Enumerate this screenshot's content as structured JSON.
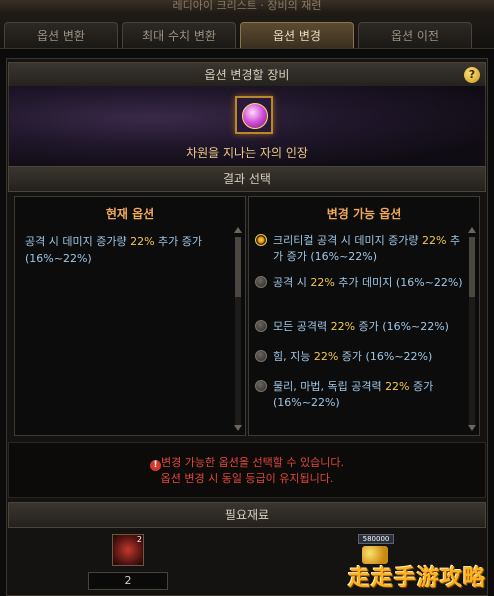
{
  "window": {
    "title": "레디아이 크리스트 · 장비의 재련"
  },
  "tabs": [
    {
      "label": "옵션 변환",
      "active": false
    },
    {
      "label": "최대 수치 변환",
      "active": false
    },
    {
      "label": "옵션 변경",
      "active": true
    },
    {
      "label": "옵션 이전",
      "active": false
    }
  ],
  "target_section": {
    "header": "옵션 변경할 장비",
    "help": "?",
    "item_name": "차원을 지나는 자의 인장"
  },
  "result_section": {
    "header": "결과 선택"
  },
  "current_options": {
    "title": "현재 옵션",
    "text_before": "공격 시 데미지 증가량 ",
    "highlight": "22%",
    "text_after": " 추가 증가 (16%~22%)"
  },
  "available_options": {
    "title": "변경 가능 옵션",
    "items": [
      {
        "before": "크리티컬 공격 시 데미지 증가량 ",
        "hl": "22%",
        "after": " 추가 증가 (16%~22%)",
        "selected": true
      },
      {
        "before": "공격 시 ",
        "hl": "22%",
        "after": " 추가 데미지 (16%~22%)",
        "selected": false
      },
      {
        "before": "모든 공격력 ",
        "hl": "22%",
        "after": " 증가 (16%~22%)",
        "selected": false
      },
      {
        "before": "힘, 지능 ",
        "hl": "22%",
        "after": " 증가 (16%~22%)",
        "selected": false
      },
      {
        "before": "물리, 마법, 독립 공격력 ",
        "hl": "22%",
        "after": " 증가 (16%~22%)",
        "selected": false
      }
    ]
  },
  "notice": {
    "line1": "변경 가능한 옵션을 선택할 수 있습니다.",
    "line2": "옵션 변경 시 동일 등급이 유지됩니다."
  },
  "materials": {
    "header": "필요재료",
    "item1_badge": "2",
    "item1_count": "2",
    "gold_label": "580000"
  },
  "watermark": "走走手游攻略"
}
